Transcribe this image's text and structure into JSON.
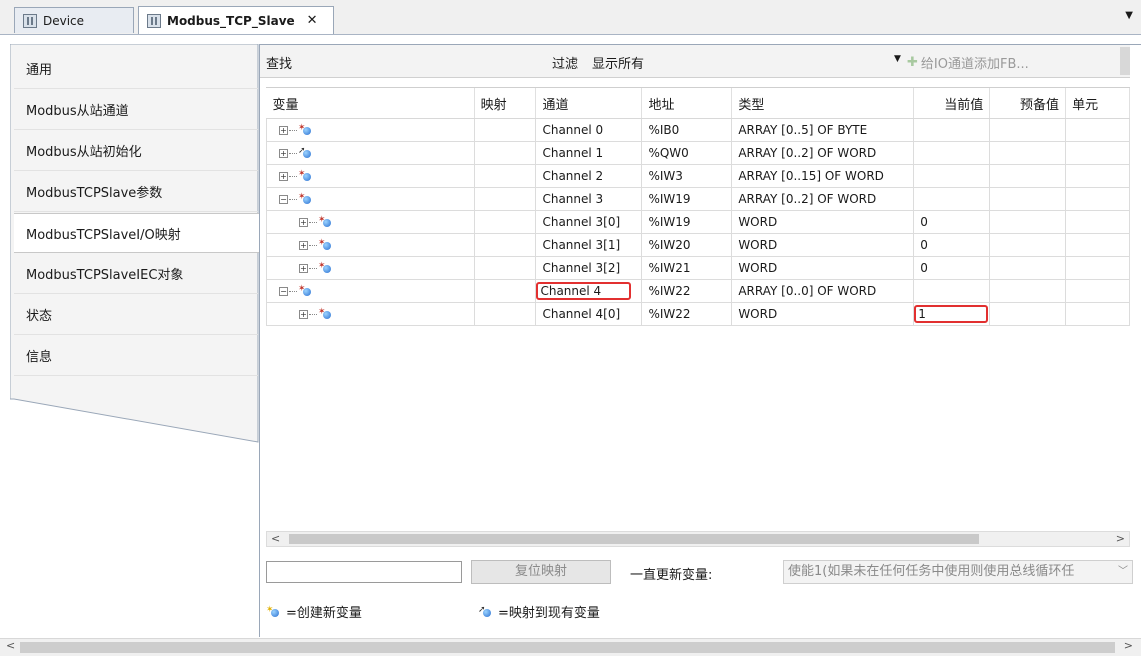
{
  "tabs": [
    {
      "label": "Device",
      "active": false
    },
    {
      "label": "Modbus_TCP_Slave",
      "active": true
    }
  ],
  "tab_close": "✕",
  "sidebar": {
    "items": [
      {
        "label": "通用"
      },
      {
        "label": "Modbus从站通道"
      },
      {
        "label": "Modbus从站初始化"
      },
      {
        "label": "ModbusTCPSlave参数"
      },
      {
        "label": "ModbusTCPSlaveI/O映射",
        "selected": true
      },
      {
        "label": "ModbusTCPSlaveIEC对象"
      },
      {
        "label": "状态"
      },
      {
        "label": "信息"
      }
    ]
  },
  "toolbar": {
    "find_label": "查找",
    "filter_label": "过滤",
    "filter_value": "显示所有",
    "add_fb_label": "给IO通道添加FB..."
  },
  "table": {
    "columns": [
      "变量",
      "映射",
      "通道",
      "地址",
      "类型",
      "当前值",
      "预备值",
      "单元"
    ],
    "rows": [
      {
        "level": 0,
        "expander": "+",
        "icon": "new",
        "channel": "Channel 0",
        "address": "%IB0",
        "type": "ARRAY [0..5] OF BYTE",
        "current": ""
      },
      {
        "level": 0,
        "expander": "+",
        "icon": "map",
        "channel": "Channel 1",
        "address": "%QW0",
        "type": "ARRAY [0..2] OF WORD",
        "current": ""
      },
      {
        "level": 0,
        "expander": "+",
        "icon": "new",
        "channel": "Channel 2",
        "address": "%IW3",
        "type": "ARRAY [0..15] OF WORD",
        "current": ""
      },
      {
        "level": 0,
        "expander": "−",
        "icon": "new",
        "channel": "Channel 3",
        "address": "%IW19",
        "type": "ARRAY [0..2] OF WORD",
        "current": ""
      },
      {
        "level": 1,
        "expander": "+",
        "icon": "new",
        "channel": "Channel 3[0]",
        "address": "%IW19",
        "type": "WORD",
        "current": "0"
      },
      {
        "level": 1,
        "expander": "+",
        "icon": "new",
        "channel": "Channel 3[1]",
        "address": "%IW20",
        "type": "WORD",
        "current": "0"
      },
      {
        "level": 1,
        "expander": "+",
        "icon": "new",
        "channel": "Channel 3[2]",
        "address": "%IW21",
        "type": "WORD",
        "current": "0"
      },
      {
        "level": 0,
        "expander": "−",
        "icon": "new",
        "channel": "Channel 4",
        "address": "%IW22",
        "type": "ARRAY [0..0] OF WORD",
        "current": "",
        "highlight_channel": true
      },
      {
        "level": 1,
        "expander": "+",
        "icon": "new",
        "channel": "Channel 4[0]",
        "address": "%IW22",
        "type": "WORD",
        "current": "1",
        "highlight_current": true
      }
    ]
  },
  "bottom": {
    "reset_label": "复位映射",
    "always_update_label": "一直更新变量:",
    "enable_value": "使能1(如果未在任何任务中使用则使用总线循环任",
    "legend_new": "=创建新变量",
    "legend_map": "=映射到现有变量"
  },
  "colors": {
    "highlight": "#e23030",
    "border": "#9aa7b8"
  }
}
